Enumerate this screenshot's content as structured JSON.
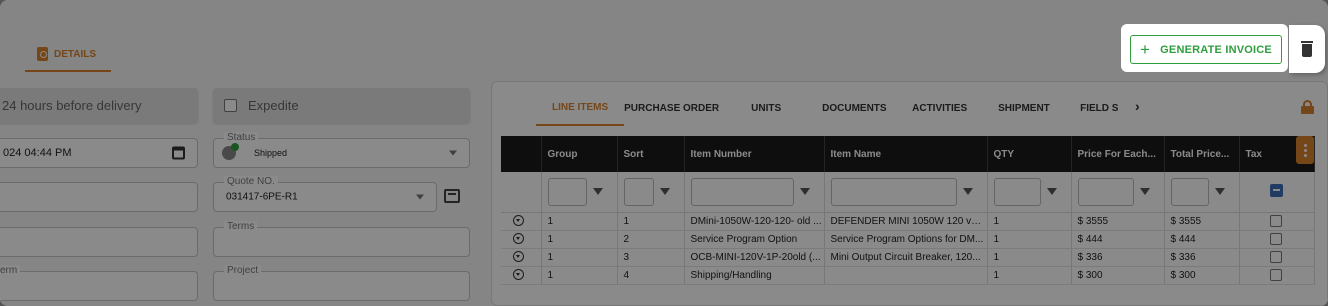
{
  "header": {
    "details_tab": "DETAILS",
    "generate_invoice_label": "GENERATE INVOICE",
    "accent_color": "#d9822b",
    "invoice_color": "#2e9e3e"
  },
  "form": {
    "delivery_note": "24 hours before delivery",
    "expedite_label": "Expedite",
    "date_value": "024 04:44 PM",
    "status": {
      "label": "Status",
      "value": "Shipped"
    },
    "quote_no": {
      "label": "Quote NO.",
      "value": "031417-6PE-R1"
    },
    "terms_label": "Terms",
    "project_label": "Project",
    "term_label": "erm"
  },
  "tabs": [
    "LINE ITEMS",
    "PURCHASE ORDER",
    "UNITS",
    "DOCUMENTS",
    "ACTIVITIES",
    "SHIPMENT",
    "FIELD S"
  ],
  "active_tab": "LINE ITEMS",
  "table": {
    "columns": [
      "Group",
      "Sort",
      "Item Number",
      "Item Name",
      "QTY",
      "Price For Each...",
      "Total Price...",
      "Tax"
    ],
    "rows": [
      {
        "group": "1",
        "sort": "1",
        "item_number": "DMini-1050W-120-120- old ...",
        "item_name": "DEFENDER MINI 1050W 120 volt...",
        "qty": "1",
        "price": "$ 3555",
        "total": "$ 3555"
      },
      {
        "group": "1",
        "sort": "2",
        "item_number": "Service Program Option",
        "item_name": "Service Program Options for DM...",
        "qty": "1",
        "price": "$ 444",
        "total": "$ 444"
      },
      {
        "group": "1",
        "sort": "3",
        "item_number": "OCB-MINI-120V-1P-20old (...",
        "item_name": "Mini Output Circuit Breaker, 120...",
        "qty": "1",
        "price": "$ 336",
        "total": "$ 336"
      },
      {
        "group": "1",
        "sort": "4",
        "item_number": "Shipping/Handling",
        "item_name": "",
        "qty": "1",
        "price": "$ 300",
        "total": "$ 300"
      }
    ]
  }
}
